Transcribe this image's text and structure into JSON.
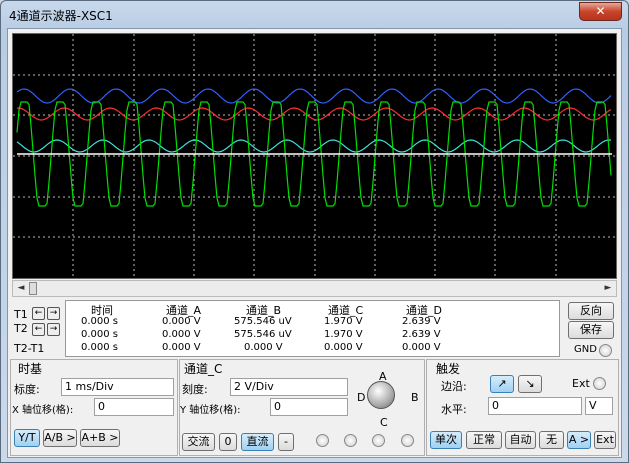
{
  "window": {
    "title": "4通道示波器-XSC1",
    "close_glyph": "✕"
  },
  "scroll": {
    "left_arrow": "◄",
    "right_arrow": "►"
  },
  "cursors": {
    "t1_label": "T1",
    "t2_label": "T2",
    "diff_label": "T2-T1",
    "left_arrow": "←",
    "right_arrow": "→"
  },
  "readout": {
    "headers": [
      "时间",
      "通道_A",
      "通道_B",
      "通道_C",
      "通道_D"
    ],
    "rows": [
      [
        "0.000 s",
        "0.000 V",
        "575.546 uV",
        "1.970 V",
        "2.639 V"
      ],
      [
        "0.000 s",
        "0.000 V",
        "575.546 uV",
        "1.970 V",
        "2.639 V"
      ],
      [
        "0.000 s",
        "0.000 V",
        "0.000 V",
        "0.000 V",
        "0.000 V"
      ]
    ]
  },
  "side_buttons": {
    "reverse": "反向",
    "save": "保存",
    "gnd": "GND"
  },
  "timebase": {
    "title": "时基",
    "scale_label": "标度:",
    "scale_value": "1 ms/Div",
    "xpos_label": "X 轴位移(格):",
    "xpos_value": "0",
    "yt": "Y/T",
    "ab": "A/B >",
    "apb": "A+B >"
  },
  "channel": {
    "title": "通道_C",
    "scale_label": "刻度:",
    "scale_value": "2  V/Div",
    "ypos_label": "Y 轴位移(格):",
    "ypos_value": "0",
    "ac": "交流",
    "zero": "0",
    "dc": "直流",
    "minus": "-",
    "knob_labels": {
      "a": "A",
      "b": "B",
      "c": "C",
      "d": "D"
    }
  },
  "trigger": {
    "title": "触发",
    "edge_label": "边沿:",
    "ext_label": "Ext",
    "edge_rise": "↗",
    "edge_fall": "↘",
    "level_label": "水平:",
    "level_value": "0",
    "level_unit": "V",
    "single": "单次",
    "normal": "正常",
    "auto": "自动",
    "none": "无",
    "a_sel": "A >",
    "ext": "Ext"
  },
  "colors": {
    "ch_a": "#ffffff",
    "ch_b": "#00e000",
    "ch_c": "#ff3030",
    "ch_d": "#3060ff",
    "ch_e": "#40e0e0"
  }
}
